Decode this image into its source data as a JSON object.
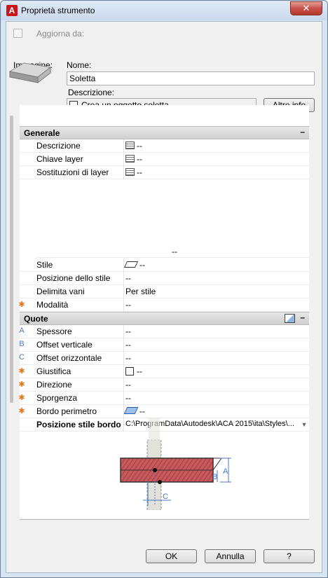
{
  "window": {
    "title": "Proprietà strumento",
    "close_glyph": "✕",
    "app_glyph": "A"
  },
  "top": {
    "update_from_label": "Aggiorna da:"
  },
  "tool": {
    "image_label": "Immagine:",
    "name_label": "Nome:",
    "name_value": "Soletta",
    "description_label": "Descrizione:",
    "description_value": "Crea un oggetto soletta.",
    "more_info_button": "Altre info"
  },
  "groups": {
    "generale": {
      "title": "Generale",
      "collapse_glyph": "–",
      "rows": [
        {
          "name": "Descrizione",
          "value": "--",
          "icon": "table-icon"
        },
        {
          "name": "Chiave layer",
          "value": "--",
          "icon": "table-icon"
        },
        {
          "name": "Sostituzioni di layer",
          "value": "--",
          "icon": "table-icon"
        }
      ],
      "preview_value": "--",
      "rows2": [
        {
          "name": "Stile",
          "value": "--",
          "icon": "slab-style-icon"
        },
        {
          "name": "Posizione dello stile",
          "value": "--"
        },
        {
          "name": "Delimita vani",
          "value": "Per stile"
        },
        {
          "name": "Modalità",
          "value": "--",
          "marker": "✱"
        }
      ]
    },
    "quote": {
      "title": "Quote",
      "collapse_glyph": "–",
      "rows": [
        {
          "marker": "A",
          "name": "Spessore",
          "value": "--"
        },
        {
          "marker": "B",
          "name": "Offset verticale",
          "value": "--"
        },
        {
          "marker": "C",
          "name": "Offset orizzontale",
          "value": "--"
        },
        {
          "marker": "✱",
          "name": "Giustifica",
          "value": "--",
          "icon": "checkbox-icon"
        },
        {
          "marker": "✱",
          "name": "Direzione",
          "value": "--"
        },
        {
          "marker": "✱",
          "name": "Sporgenza",
          "value": "--"
        },
        {
          "marker": "✱",
          "name": "Bordo perimetro",
          "value": "--",
          "icon": "edge-icon"
        },
        {
          "name": "Posizione stile bordo",
          "value": "C:\\ProgramData\\Autodesk\\ACA 2015\\ita\\Styles\\..."
        }
      ]
    }
  },
  "diagram_labels": {
    "a": "A",
    "b": "B",
    "c": "C"
  },
  "buttons": {
    "ok": "OK",
    "cancel": "Annulla",
    "help": "?"
  }
}
